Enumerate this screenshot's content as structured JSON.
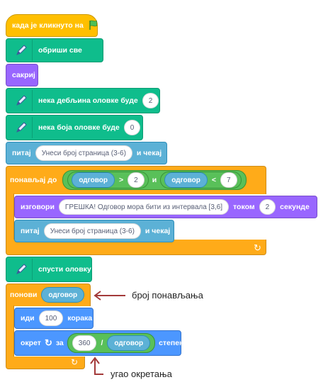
{
  "blocks": {
    "when_flag": "када је кликнуто на",
    "clear": "обриши све",
    "hide": "сакриј",
    "pen_size_label": "нека дебљина оловке буде",
    "pen_size_value": "2",
    "pen_color_label": "нека боја оловке буде",
    "pen_color_value": "0",
    "ask1_label": "питај",
    "ask1_value": "Унеси број страница (3-6)",
    "ask1_wait": "и чекај",
    "repeat_until": "понављај до",
    "answer": "одговор",
    "gt": ">",
    "gt_value": "2",
    "and": "и",
    "lt": "<",
    "lt_value": "7",
    "say_label": "изговори",
    "say_value": "ГРЕШКА! Одговор мора бити из интервала [3,6]",
    "say_for": "током",
    "say_secs": "2",
    "say_seconds_label": "секунде",
    "ask2_label": "питај",
    "ask2_value": "Унеси број страница (3-6)",
    "ask2_wait": "и чекај",
    "pen_down": "спусти оловку",
    "repeat": "понови",
    "move_label": "иди",
    "move_value": "100",
    "move_steps": "корака",
    "turn_label": "окрет",
    "turn_by": "за",
    "turn_num": "360",
    "divide": "/",
    "turn_degrees": "степени"
  },
  "annotations": {
    "repeat_count": "број понављања",
    "turn_angle": "угао окретања"
  },
  "colors": {
    "events": "#ffbf00",
    "pen": "#0fbd8c",
    "looks": "#9966ff",
    "sensing": "#5cb1d6",
    "control": "#ffab19",
    "motion": "#4c97ff",
    "operators": "#59c059",
    "arrow": "#a33a3a"
  }
}
